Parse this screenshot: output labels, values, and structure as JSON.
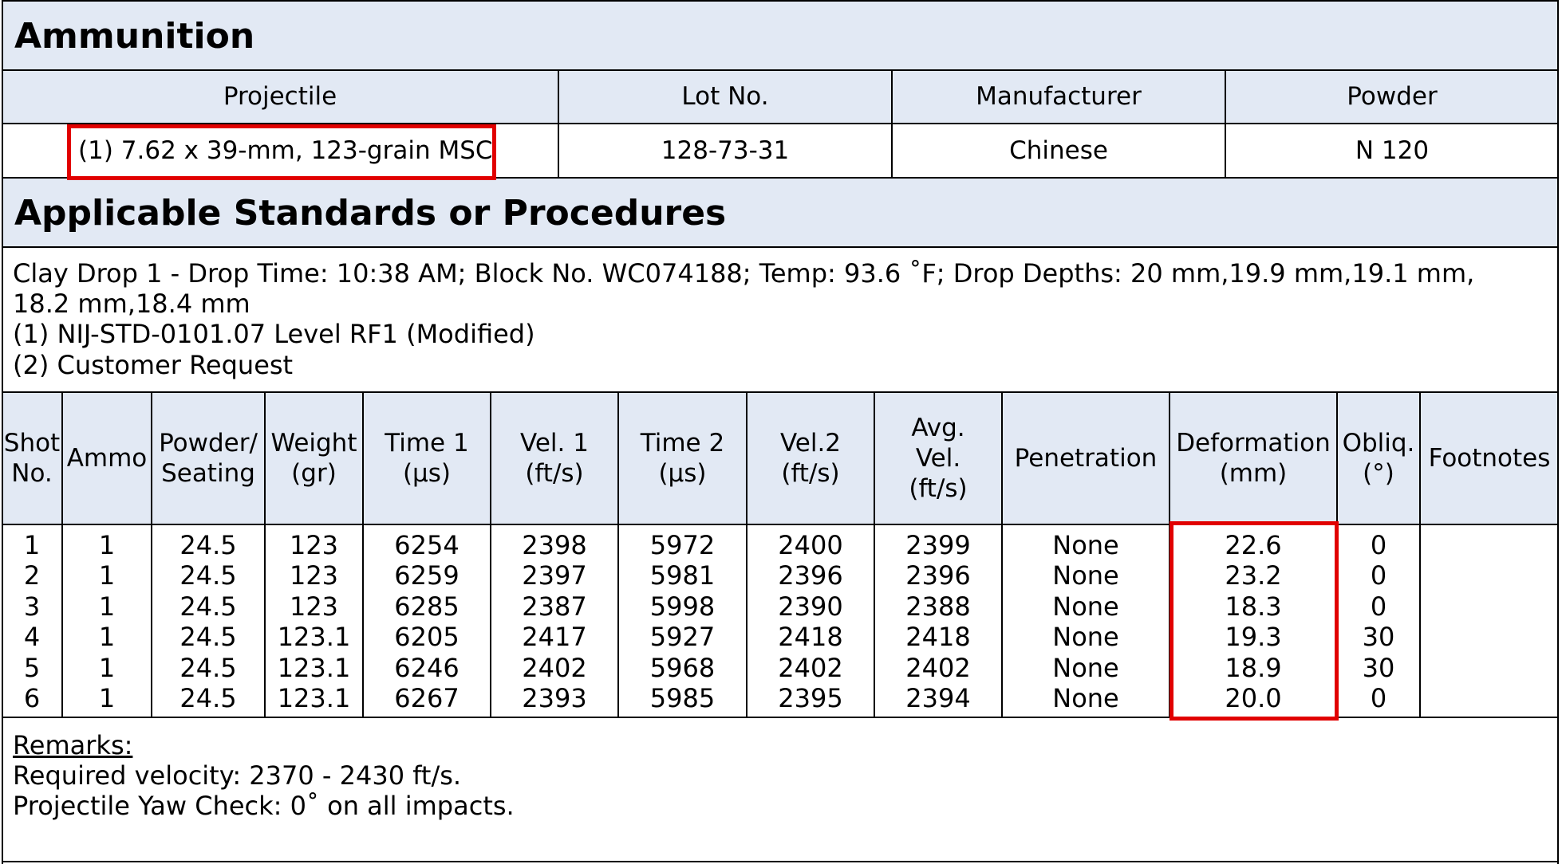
{
  "ammunition": {
    "title": "Ammunition",
    "headers": [
      "Projectile",
      "Lot No.",
      "Manufacturer",
      "Powder"
    ],
    "values": [
      "(1) 7.62 x 39-mm, 123-grain MSC",
      "128-73-31",
      "Chinese",
      "N 120"
    ]
  },
  "standards": {
    "title": "Applicable Standards or Procedures",
    "lines": [
      "Clay Drop 1 - Drop Time: 10:38 AM; Block No. WC074188; Temp: 93.6 ˚F; Drop Depths: 20 mm,19.9 mm,19.1 mm,",
      "18.2 mm,18.4 mm",
      "(1) NIJ-STD-0101.07 Level RF1 (Modified)",
      "(2) Customer Request"
    ]
  },
  "shots": {
    "headers": [
      [
        "Shot",
        "No."
      ],
      [
        "Ammo"
      ],
      [
        "Powder/",
        "Seating"
      ],
      [
        "Weight",
        "(gr)"
      ],
      [
        "Time 1",
        "(μs)"
      ],
      [
        "Vel. 1",
        "(ft/s)"
      ],
      [
        "Time 2",
        "(μs)"
      ],
      [
        "Vel.2",
        "(ft/s)"
      ],
      [
        "Avg.",
        "Vel.",
        "(ft/s)"
      ],
      [
        "Penetration"
      ],
      [
        "Deformation",
        "(mm)"
      ],
      [
        "Obliq.",
        "(°)"
      ],
      [
        "Footnotes"
      ]
    ],
    "columns": [
      [
        "1",
        "2",
        "3",
        "4",
        "5",
        "6"
      ],
      [
        "1",
        "1",
        "1",
        "1",
        "1",
        "1"
      ],
      [
        "24.5",
        "24.5",
        "24.5",
        "24.5",
        "24.5",
        "24.5"
      ],
      [
        "123",
        "123",
        "123",
        "123.1",
        "123.1",
        "123.1"
      ],
      [
        "6254",
        "6259",
        "6285",
        "6205",
        "6246",
        "6267"
      ],
      [
        "2398",
        "2397",
        "2387",
        "2417",
        "2402",
        "2393"
      ],
      [
        "5972",
        "5981",
        "5998",
        "5927",
        "5968",
        "5985"
      ],
      [
        "2400",
        "2396",
        "2390",
        "2418",
        "2402",
        "2395"
      ],
      [
        "2399",
        "2396",
        "2388",
        "2418",
        "2402",
        "2394"
      ],
      [
        "None",
        "None",
        "None",
        "None",
        "None",
        "None"
      ],
      [
        "22.6",
        "23.2",
        "18.3",
        "19.3",
        "18.9",
        "20.0"
      ],
      [
        "0",
        "0",
        "0",
        "30",
        "30",
        "0"
      ],
      [
        "",
        "",
        "",
        "",
        "",
        ""
      ]
    ]
  },
  "remarks": {
    "title": "Remarks:",
    "lines": [
      "Required velocity: 2370 - 2430 ft/s.",
      "Projectile Yaw Check: 0˚ on all impacts."
    ]
  },
  "highlight_color": "#e10000",
  "band_color": "#e2e9f4"
}
